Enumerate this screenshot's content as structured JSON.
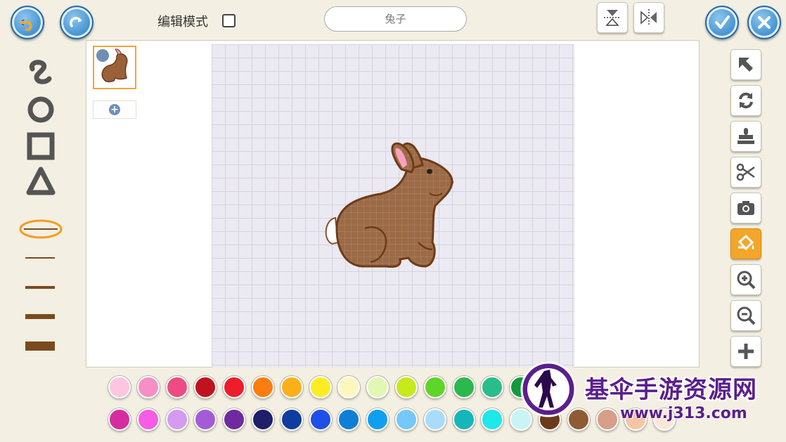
{
  "toolbar": {
    "edit_mode_label": "编辑模式",
    "sprite_name": "兔子"
  },
  "left_tools": [
    "freehand-tool",
    "ellipse-tool",
    "rectangle-tool",
    "triangle-tool"
  ],
  "stroke_sizes": [
    "stroke-size-1",
    "stroke-size-2",
    "stroke-size-3",
    "stroke-size-4"
  ],
  "right_tools": [
    "select-icon",
    "rotate-icon",
    "stamp-icon",
    "scissors-icon",
    "camera-icon",
    "fill-bucket-icon",
    "zoom-in-icon",
    "zoom-out-icon",
    "plus-icon"
  ],
  "active_tool": "fill-bucket-icon",
  "palette_row1": [
    "#fcc6e0",
    "#f78fc6",
    "#ef4b83",
    "#c1121f",
    "#ee1d2b",
    "#fb7d10",
    "#fbb01b",
    "#fdec22",
    "#fdf6bf",
    "#e2f7b4",
    "#c6ea1a",
    "#5fd42a",
    "#2cb84a",
    "#29bd8b",
    "#139a3e"
  ],
  "palette_row2": [
    "#d72ca0",
    "#f65ce4",
    "#d59bf0",
    "#a45cd6",
    "#6e2a9e",
    "#1e1e6b",
    "#0f3c9e",
    "#1f4fe8",
    "#0e7fd6",
    "#109ff0",
    "#76c8f8",
    "#a9dcfb",
    "#15b6b9",
    "#1ee8e8",
    "#c9f4f4",
    "#6a3a1c",
    "#8f5b35",
    "#d59f8a",
    "#f6c5a6",
    "#fbe7da"
  ],
  "watermark": {
    "title": "基伞手游资源网",
    "url": "www.j313.com"
  }
}
